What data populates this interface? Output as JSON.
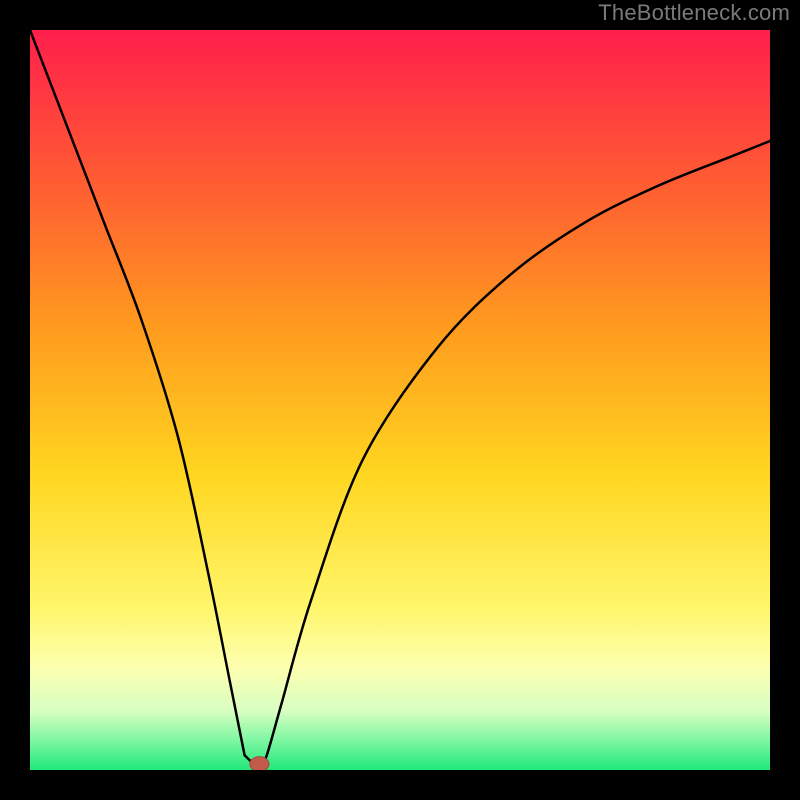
{
  "watermark": "TheBottleneck.com",
  "colors": {
    "frame": "#000000",
    "watermark_text": "#7a7a7a",
    "curve": "#000000",
    "marker_fill": "#c35b4d",
    "marker_stroke": "#a24a3f",
    "gradient_stops": [
      {
        "offset": 0.0,
        "color": "#ff1f4b"
      },
      {
        "offset": 0.2,
        "color": "#ff5a33"
      },
      {
        "offset": 0.4,
        "color": "#ff9a1f"
      },
      {
        "offset": 0.6,
        "color": "#ffd61f"
      },
      {
        "offset": 0.78,
        "color": "#fff66b"
      },
      {
        "offset": 0.86,
        "color": "#fdffae"
      },
      {
        "offset": 0.92,
        "color": "#d8ffc2"
      },
      {
        "offset": 0.96,
        "color": "#7ef7a2"
      },
      {
        "offset": 1.0,
        "color": "#20e87a"
      }
    ]
  },
  "chart_data": {
    "type": "line",
    "title": "",
    "xlabel": "",
    "ylabel": "",
    "xlim": [
      0,
      100
    ],
    "ylim": [
      0,
      100
    ],
    "grid": false,
    "legend": false,
    "series": [
      {
        "name": "bottleneck-curve",
        "x": [
          0,
          5,
          10,
          15,
          20,
          24,
          27,
          29,
          30,
          31,
          32,
          34,
          38,
          45,
          55,
          65,
          75,
          85,
          95,
          100
        ],
        "y": [
          100,
          87,
          74,
          61,
          45,
          27,
          12,
          2,
          0,
          0,
          2,
          9,
          23,
          42,
          57,
          67,
          74,
          79,
          83,
          85
        ]
      }
    ],
    "marker": {
      "x": 31,
      "y": 0.8,
      "rx": 1.3,
      "ry": 1.0
    },
    "notch": {
      "x_start": 29,
      "x_end": 31,
      "y": 0
    }
  }
}
